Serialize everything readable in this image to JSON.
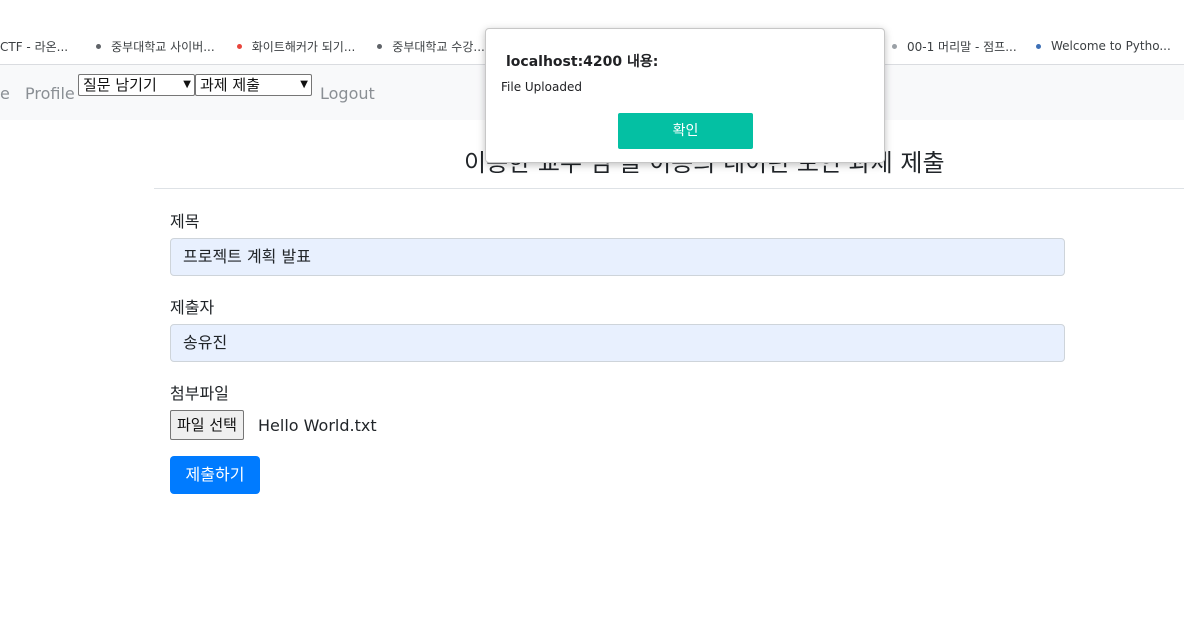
{
  "bookmarks": [
    {
      "label": "CTF - 라온...",
      "color": ""
    },
    {
      "label": "중부대학교 사이버...",
      "color": "#5f6368"
    },
    {
      "label": "화이트해커가 되기...",
      "color": "#e8453c"
    },
    {
      "label": "중부대학교 수강...",
      "color": "#5f6368"
    },
    {
      "label": "00-1 머리말 - 점프...",
      "color": "#9aa0a6"
    },
    {
      "label": "Welcome to Pytho...",
      "color": "#3d6fb6"
    }
  ],
  "nav": {
    "home_fragment": "e",
    "profile": "Profile",
    "question_select": "질문 남기기",
    "assignment_select": "과제 제출",
    "logout": "Logout"
  },
  "page": {
    "title": "이용한 교수 님 을 이용의 네이런 보인 과제 제출"
  },
  "form": {
    "title_label": "제목",
    "title_value": "프로젝트 계획 발표",
    "author_label": "제출자",
    "author_value": "송유진",
    "file_label": "첨부파일",
    "file_button": "파일 선택",
    "file_name": "Hello World.txt",
    "submit": "제출하기"
  },
  "dialog": {
    "title": "localhost:4200 내용:",
    "message": "File Uploaded",
    "ok": "확인"
  }
}
